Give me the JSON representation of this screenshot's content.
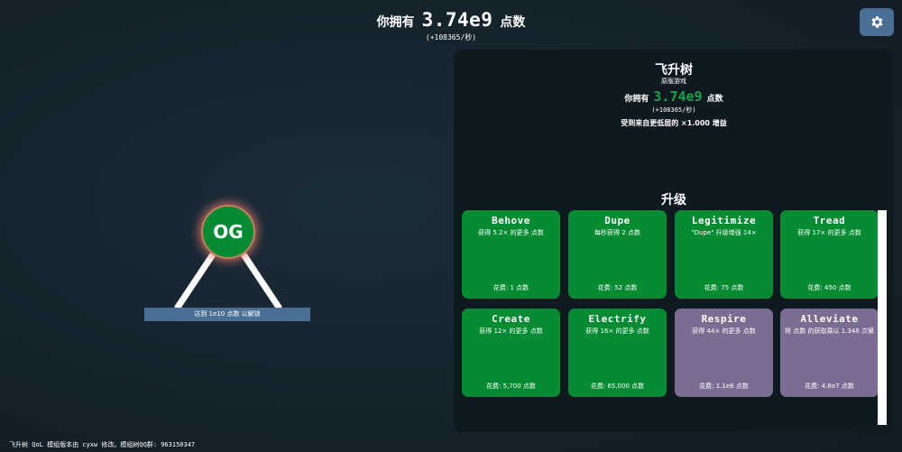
{
  "header": {
    "prefix": "你拥有",
    "points": "3.74e9",
    "suffix": "点数",
    "rate": "(+108365/秒)"
  },
  "settings": {
    "icon": "gear-icon"
  },
  "tree": {
    "node_label": "OG",
    "unlock_text": "达到 1e10 点数 以解锁"
  },
  "panel": {
    "title": "飞升树",
    "subtitle": "原版游戏",
    "points_prefix": "你拥有",
    "points": "3.74e9",
    "points_suffix": "点数",
    "rate": "(+108365/秒)",
    "boost": "受到来自更低层的 ×1.000 增益",
    "upgrades_heading": "升级"
  },
  "upgrades": [
    {
      "title": "Behove",
      "desc": "获得 5.2× 的更多 点数",
      "cost": "花费: 1 点数",
      "locked": false
    },
    {
      "title": "Dupe",
      "desc": "每秒获得 2 点数",
      "cost": "花费: 52 点数",
      "locked": false
    },
    {
      "title": "Legitimize",
      "desc": "\"Dupe\" 升级增强 14×",
      "cost": "花费: 75 点数",
      "locked": false
    },
    {
      "title": "Tread",
      "desc": "获得 17× 的更多 点数",
      "cost": "花费: 450 点数",
      "locked": false
    },
    {
      "title": "Create",
      "desc": "获得 12× 的更多 点数",
      "cost": "花费: 5,700 点数",
      "locked": false
    },
    {
      "title": "Electrify",
      "desc": "获得 16× 的更多 点数",
      "cost": "花费: 65,000 点数",
      "locked": false
    },
    {
      "title": "Respire",
      "desc": "获得 44× 的更多 点数",
      "cost": "花费: 1.1e6 点数",
      "locked": true
    },
    {
      "title": "Alleviate",
      "desc": "将 点数 的获取乘以 1.348 次幂",
      "cost": "花费: 4.8e7 点数",
      "locked": true
    }
  ],
  "footer": {
    "line1": "飞升树 QoL 模组版本由 cyxw 修改。模组树QQ群: 963150347"
  },
  "colors": {
    "bought": "#058b31",
    "locked": "#7b6c91",
    "accent_blue": "#4a6f95",
    "points_green": "#16a34a"
  }
}
